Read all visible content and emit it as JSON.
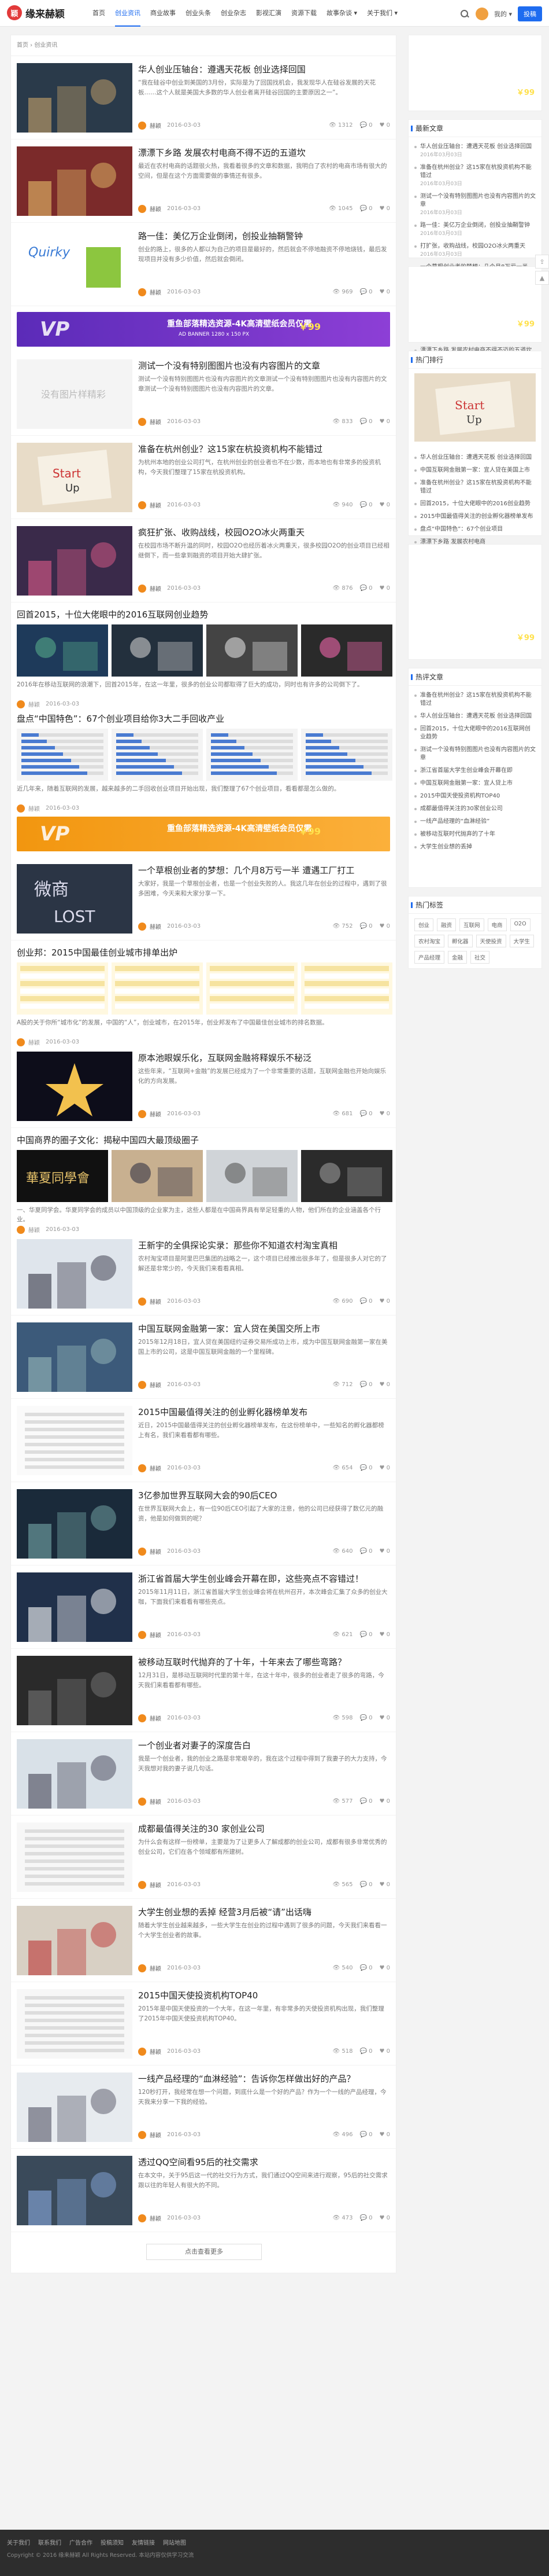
{
  "site": {
    "logo_text": "缘来赫颖",
    "logo_mark": "颖"
  },
  "nav": [
    "首页",
    "创业资讯",
    "商业故事",
    "创业头条",
    "创业杂志",
    "影视汇演",
    "资源下载",
    "故事杂谈 ▾",
    "关于我们 ▾"
  ],
  "user": {
    "name": "我的 ▾",
    "publish": "投稿"
  },
  "breadcrumb": "首页 › 创业资讯",
  "items": [
    {
      "type": "std",
      "title": "华人创业压轴台：遵遇天花板 创业选择回国",
      "excerpt": "“我在硅谷中创业到美国的3月份，实际是为了回国找机会，我发现华人在硅谷发展的天花板……这个人就是美国大多数的华人创业者离开硅谷回国的主要原因之一”。",
      "date": "2016-03-03",
      "views": "1312",
      "comments": "0",
      "likes": "0",
      "img": "city"
    },
    {
      "type": "std",
      "title": "漂漂下乡路 发展农村电商不得不迈的五道坎",
      "excerpt": "最近在农村电商的话题很火热，我看着很多的文章和数据，我明白了农村的电商市场有很大的空间，但是在这个方面需要做的事情还有很多。",
      "date": "2016-03-03",
      "views": "1045",
      "comments": "0",
      "likes": "0",
      "img": "shop"
    },
    {
      "type": "std",
      "title": "路一佳：美亿万企业倒闭，创投业抽鞘警钟",
      "excerpt": "创业的路上，很多的人都以为自己的项目是最好的，然后就会不停地融资不停地烧钱，最后发现项目并没有多少价值，然后就会倒闭。",
      "date": "2016-03-03",
      "views": "969",
      "comments": "0",
      "likes": "0",
      "img": "quirky"
    },
    {
      "type": "ad",
      "style": "purple",
      "text": "重鱼部落精选资源-4K高清壁纸会员仅需",
      "sub": "AD BANNER 1280 x 150 PX",
      "price": "￥99"
    },
    {
      "type": "std",
      "title": "测试一个没有特别图图片也没有内容图片的文章",
      "excerpt": "测试一个没有特别图图片也没有内容图片的文章测试一个没有特别图图片也没有内容图片的文章测试一个没有特别图图片也没有内容图片的文章。",
      "date": "2016-03-03",
      "views": "833",
      "comments": "0",
      "likes": "0",
      "img": "placeholder"
    },
    {
      "type": "std",
      "title": "准备在杭州创业？这15家在杭投资机构不能错过",
      "excerpt": "为杭州本地的创业公司打气，在杭州创业的创业者也不在少数，而本地也有非常多的投资机构，今天我们整理了15家在杭投资机构。",
      "date": "2016-03-03",
      "views": "940",
      "comments": "0",
      "likes": "0",
      "img": "startup"
    },
    {
      "type": "std",
      "title": "疯狂扩张、收购战线，校园O2O冰火两重天",
      "excerpt": "在校园市场不断升温的同时，校园O2O也经历着冰火两重天，很多校园O2O的创业项目已经相继倒下，而一些拿到融资的项目开始大肆扩张。",
      "date": "2016-03-03",
      "views": "876",
      "comments": "0",
      "likes": "0",
      "img": "party"
    },
    {
      "type": "gallery",
      "title": "回首2015，十位大佬眼中的2016互联网创业趋势",
      "excerpt": "2016年在移动互联网的浪潮下，回首2015年，在这一年里，很多的创业公司都取得了巨大的成功，同时也有许多的公司倒下了。",
      "date": "2016-03-03",
      "imgs": [
        "a",
        "b",
        "c",
        "d"
      ]
    },
    {
      "type": "gallery",
      "title": "盘点“中国特色”：67个创业项目给你3大二手回收产业",
      "excerpt": "近几年来，随着互联网的发展，越来越多的二手回收创业项目开始出现，我们整理了67个创业项目，看看都是怎么做的。",
      "date": "2016-03-03",
      "imgs": [
        "chart",
        "chart",
        "chart",
        "chart"
      ]
    },
    {
      "type": "ad",
      "style": "orange",
      "text": "重鱼部落精选资源-4K高清壁纸会员仅需",
      "sub": "",
      "price": "￥99"
    },
    {
      "type": "std",
      "title": "一个草根创业者的梦想：几个月8万亏一半 遭遇工厂打工",
      "excerpt": "大家好，我是一个草根创业者，也是一个创业失败的人。我这几年在创业的过程中，遇到了很多困难，今天来和大家分享一下。",
      "date": "2016-03-03",
      "views": "752",
      "comments": "0",
      "likes": "0",
      "img": "lost"
    },
    {
      "type": "gallery",
      "title": "创业邦：2015中国最佳创业城市排单出炉",
      "excerpt": "A股的关于你所“城市化”的发展，中国的“人”，创业城市，在2015年，创业邦发布了中国最佳创业城市的排名数据。",
      "date": "2016-03-03",
      "imgs": [
        "table",
        "table",
        "table",
        "table"
      ]
    },
    {
      "type": "std",
      "title": "原本池眼娱乐化，互联网金融将释娱乐不秘泛",
      "excerpt": "这些年来，“互联网+金融”的发展已经成为了一个非常重要的话题，互联网金融也开始向娱乐化的方向发展。",
      "date": "2016-03-03",
      "views": "681",
      "comments": "0",
      "likes": "0",
      "img": "star"
    },
    {
      "type": "gallery",
      "title": "中国商界的圈子文化：揭秘中国四大最顶级圈子",
      "excerpt": "一、华夏同学会。华夏同学会的成员以中国顶级的企业家为主，这些人都是在中国商界具有举足轻重的人物，他们所在的企业涵盖各个行业。",
      "date": "2016-03-03",
      "imgs": [
        "club",
        "people",
        "meeting",
        "cars"
      ]
    },
    {
      "type": "std",
      "title": "王新宇的全俱探论实录：那些你不知道农村淘宝真相",
      "excerpt": "农村淘宝项目是阿里巴巴集团的战略之一，这个项目已经推出很多年了，但是很多人对它的了解还是非常少的，今天我们来看看真相。",
      "date": "2016-03-03",
      "views": "690",
      "comments": "0",
      "likes": "0",
      "img": "talk"
    },
    {
      "type": "std",
      "title": "中国互联网金融第一家：宜人贷在美国交所上市",
      "excerpt": "2015年12月18日，宜人贷在美国纽约证券交易所成功上市，成为中国互联网金融第一家在美国上市的公司，这是中国互联网金融的一个里程碑。",
      "date": "2016-03-03",
      "views": "712",
      "comments": "0",
      "likes": "0",
      "img": "nyse"
    },
    {
      "type": "std",
      "title": "2015中国最值得关注的创业孵化器榜单发布",
      "excerpt": "近日，2015中国最值得关注的创业孵化器榜单发布，在这份榜单中，一些知名的孵化器都榜上有名，我们来看看都有哪些。",
      "date": "2016-03-03",
      "views": "654",
      "comments": "0",
      "likes": "0",
      "img": "doc"
    },
    {
      "type": "std",
      "title": "3亿参加世界互联网大会的90后CEO",
      "excerpt": "在世界互联网大会上，有一位90后CEO引起了大家的注意，他的公司已经获得了数亿元的融资，他是如何做到的呢？",
      "date": "2016-03-03",
      "views": "640",
      "comments": "0",
      "likes": "0",
      "img": "ceo"
    },
    {
      "type": "std",
      "title": "浙江省首届大学生创业峰会开幕在即，这些亮点不容错过！",
      "excerpt": "2015年11月11日，浙江省首届大学生创业峰会将在杭州召开，本次峰会汇集了众多的创业大咖，下面我们来看看有哪些亮点。",
      "date": "2016-03-03",
      "views": "621",
      "comments": "0",
      "likes": "0",
      "img": "summit"
    },
    {
      "type": "std",
      "title": "被移动互联时代抛弃的了十年，十年来去了哪些弯路？",
      "excerpt": "12月31日，是移动互联网时代里的第十年，在这十年中，很多的创业者走了很多的弯路，今天我们来看看都有哪些。",
      "date": "2016-03-03",
      "views": "598",
      "comments": "0",
      "likes": "0",
      "img": "dark"
    },
    {
      "type": "std",
      "title": "一个创业者对妻子的深度告白",
      "excerpt": "我是一个创业者，我的创业之路是非常艰辛的，我在这个过程中得到了我妻子的大力支持，今天我想对我的妻子说几句话。",
      "date": "2016-03-03",
      "views": "577",
      "comments": "0",
      "likes": "0",
      "img": "couple"
    },
    {
      "type": "std",
      "title": "成都最值得关注的30 家创业公司",
      "excerpt": "为什么会有这样一份榜单，主要是为了让更多人了解成都的创业公司，成都有很多非常优秀的创业公司，它们在各个领域都有所建树。",
      "date": "2016-03-03",
      "views": "565",
      "comments": "0",
      "likes": "0",
      "img": "list"
    },
    {
      "type": "std",
      "title": "大学生创业想的丢掉 经营3月后被“请”出话嗨",
      "excerpt": "随着大学生创业越来越多，一些大学生在创业的过程中遇到了很多的问题，今天我们来看看一个大学生创业者的故事。",
      "date": "2016-03-03",
      "views": "540",
      "comments": "0",
      "likes": "0",
      "img": "campus"
    },
    {
      "type": "std",
      "title": "2015中国天使投资机构TOP40",
      "excerpt": "2015年是中国天使投资的一个大年，在这一年里，有非常多的天使投资机构出现，我们整理了2015年中国天使投资机构TOP40。",
      "date": "2016-03-03",
      "views": "518",
      "comments": "0",
      "likes": "0",
      "img": "table2"
    },
    {
      "type": "std",
      "title": "一线产品经理的“血淋经验”：告诉你怎样做出好的产品？",
      "excerpt": "120秒打开，我经常在想一个问题，到底什么是一个好的产品？作为一个一线的产品经理，今天我来分享一下我的经验。",
      "date": "2016-03-03",
      "views": "496",
      "comments": "0",
      "likes": "0",
      "img": "pm"
    },
    {
      "type": "std",
      "title": "透过QQ空间看95后的社交需求",
      "excerpt": "在本文中，关于95后这一代的社交行为方式，我们通过QQ空间来进行观察，95后的社交需求跟以往的年轻人有很大的不同。",
      "date": "2016-03-03",
      "views": "473",
      "comments": "0",
      "likes": "0",
      "img": "crowd"
    }
  ],
  "more": "点击查看更多",
  "sidebar": {
    "ad1": {
      "text": "4K高清壁纸会员仅需",
      "price": "￥99"
    },
    "latest_title": "最新文章",
    "latest": [
      {
        "t": "华人创业压轴台：遭遇天花板 创业选择回国",
        "d": "2016年03月03日"
      },
      {
        "t": "准备在杭州创业？这15家在杭投资机构不能错过",
        "d": "2016年03月03日"
      },
      {
        "t": "测试一个没有特别图图片也没有内容图片的文章",
        "d": "2016年03月03日"
      },
      {
        "t": "路一佳：美亿万企业倒闭，创投业抽鞘警钟",
        "d": "2016年03月03日"
      },
      {
        "t": "打扩张，收购战线，校园O2O冰火两重天",
        "d": "2016年03月03日"
      },
      {
        "t": "一个草根创业者的梦想：几个月8万亏一半",
        "d": "2016年03月03日"
      },
      {
        "t": "盘点“中国特色”：67个创业项目",
        "d": "2016年03月03日"
      },
      {
        "t": "回首2015，十位大佬眼中的2016创业趋势",
        "d": "2016年03月03日"
      },
      {
        "t": "中国商界的圈子文化：揭秘四大顶级圈子",
        "d": "2016年03月03日"
      },
      {
        "t": "漂漂下乡路 发展农村电商不得不迈的五道坎",
        "d": "2016年03月03日"
      }
    ],
    "ad2": {
      "text": "4K高清壁纸会员仅需",
      "price": "￥99"
    },
    "hot_title": "热门排行",
    "hot": [
      "华人创业压轴台：遭遇天花板 创业选择回国",
      "中国互联网金融第一家：宜人贷在美国上市",
      "准备在杭州创业？这15家在杭投资机构不能错过",
      "回首2015，十位大佬眼中的2016创业趋势",
      "2015中国最值得关注的创业孵化器榜单发布",
      "盘点“中国特色”：67个创业项目",
      "漂漂下乡路 发展农村电商"
    ],
    "ad3": {
      "text": "4K高清壁纸会员仅需",
      "price": "￥99"
    },
    "rec_title": "热评文章",
    "rec": [
      "准备在杭州创业？这15家在杭投资机构不能错过",
      "华人创业压轴台：遭遇天花板 创业选择回国",
      "回首2015，十位大佬眼中的2016互联网创业趋势",
      "测试一个没有特别图图片也没有内容图片的文章",
      "浙江省首届大学生创业峰会开幕在即",
      "中国互联网金融第一家：宜人贷上市",
      "2015中国天使投资机构TOP40",
      "成都最值得关注的30家创业公司",
      "一线产品经理的“血淋经验”",
      "被移动互联时代抛弃的了十年",
      "大学生创业想的丢掉"
    ],
    "tags_title": "热门标签",
    "tags": [
      "创业",
      "融资",
      "互联网",
      "电商",
      "O2O",
      "农村淘宝",
      "孵化器",
      "天使投资",
      "大学生",
      "产品经理",
      "金融",
      "社交"
    ]
  },
  "footer": {
    "links": [
      "关于我们",
      "联系我们",
      "广告合作",
      "投稿须知",
      "友情链接",
      "网站地图"
    ],
    "copy": "Copyright © 2016 缘来赫颖 All Rights Reserved. 本站内容仅供学习交流"
  },
  "colors": {
    "accent": "#1e6cf0",
    "ad_purple": "#6a32c4",
    "ad_orange": "#f5a21f"
  }
}
